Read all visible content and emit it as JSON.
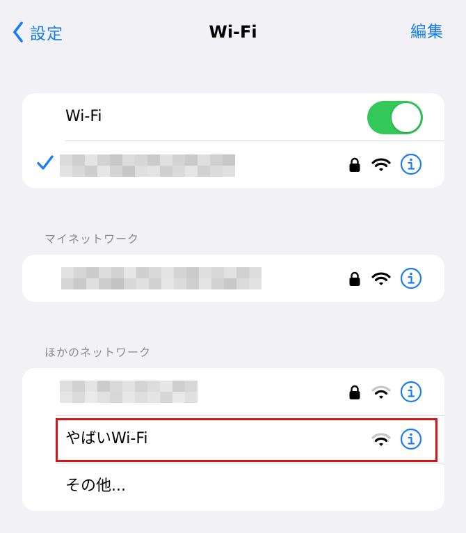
{
  "navbar": {
    "back_label": "設定",
    "title": "Wi-Fi",
    "edit_label": "編集"
  },
  "wifi_card": {
    "toggle_label": "Wi-Fi",
    "toggle_on": true,
    "connected_network": {
      "name_obscured": true,
      "secured": true,
      "checked": true
    }
  },
  "my_networks": {
    "header": "マイネットワーク"
  },
  "other_networks": {
    "header": "ほかのネットワーク",
    "items": [
      {
        "name_obscured": true,
        "secured": true
      },
      {
        "name": "やばいWi-Fi",
        "secured": false,
        "highlighted": true
      },
      {
        "name": "その他..."
      }
    ]
  },
  "colors": {
    "accent": "#1a7cf2",
    "toggle_on": "#34c759",
    "highlight_border": "#d4141b",
    "background": "#f2f2f6"
  }
}
